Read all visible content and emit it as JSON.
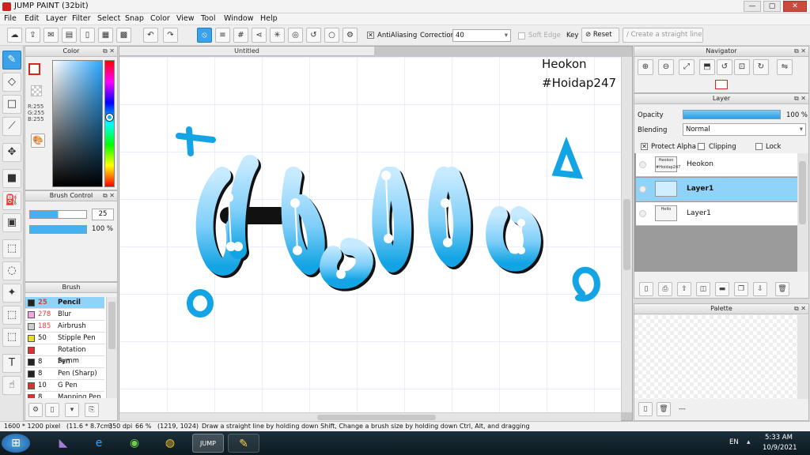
{
  "window": {
    "title": "JUMP PAINT (32bit)",
    "minimize": "—",
    "maximize": "▢",
    "close": "✕"
  },
  "menu": [
    "File",
    "Edit",
    "Layer",
    "Filter",
    "Select",
    "Snap",
    "Color",
    "View",
    "Tool",
    "Window",
    "Help"
  ],
  "toolbar": {
    "antialiasing_label": "AntiAliasing",
    "correction_label": "Correction",
    "correction_value": "40",
    "soft_edge_label": "Soft Edge",
    "key_label": "Key",
    "reset_label": "Reset",
    "straight_line_label": "Create a straight line"
  },
  "color_panel": {
    "title": "Color",
    "r": "R:255",
    "g": "G:255",
    "b": "B:255"
  },
  "brush_control": {
    "title": "Brush Control",
    "size": "25",
    "opacity": "100 %"
  },
  "brush_panel": {
    "title": "Brush",
    "items": [
      {
        "size": "25",
        "name": "Pencil",
        "color": "#222222"
      },
      {
        "size": "278",
        "name": "Blur",
        "color": "#f2a6e6"
      },
      {
        "size": "185",
        "name": "Airbrush",
        "color": "#cccccc"
      },
      {
        "size": "50",
        "name": "Stipple Pen",
        "color": "#e8e020"
      },
      {
        "size": "",
        "name": "Rotation Symm",
        "color": "#e03030"
      },
      {
        "size": "8",
        "name": "Pen",
        "color": "#222222"
      },
      {
        "size": "8",
        "name": "Pen (Sharp)",
        "color": "#222222"
      },
      {
        "size": "10",
        "name": "G Pen",
        "color": "#e03030"
      },
      {
        "size": "8",
        "name": "Mapping Pen",
        "color": "#e03030"
      }
    ]
  },
  "canvas": {
    "tab_title": "Untitled",
    "watermark_line1": "Heokon",
    "watermark_line2": "#Hoidap247",
    "artwork_text": "Hello"
  },
  "navigator": {
    "title": "Navigator"
  },
  "layer_panel": {
    "title": "Layer",
    "opacity_label": "Opacity",
    "opacity_value": "100 %",
    "blending_label": "Blending",
    "blending_value": "Normal",
    "protect_alpha_label": "Protect Alpha",
    "clipping_label": "Clipping",
    "lock_label": "Lock",
    "layers": [
      {
        "name": "Heokon",
        "thumb": "Heokon #Hoidap247"
      },
      {
        "name": "Layer1",
        "thumb": "",
        "selected": true
      },
      {
        "name": "Layer1",
        "thumb": "Hello"
      }
    ]
  },
  "palette_panel": {
    "title": "Palette",
    "footer": "---"
  },
  "status": {
    "size": "1600 * 1200 pixel",
    "cm": "(11.6 * 8.7cm)",
    "dpi": "350 dpi",
    "zoom": "66 %",
    "coords": "(1219, 1024)",
    "hint": "Draw a straight line by holding down Shift, Change a brush size by holding down Ctrl, Alt, and dragging"
  },
  "taskbar": {
    "lang": "EN",
    "time": "5:33 AM",
    "date": "10/9/2021"
  },
  "colors": {
    "accent": "#3ba2ea",
    "art_light": "#bfe6ff",
    "art_dark": "#12a4e4"
  }
}
